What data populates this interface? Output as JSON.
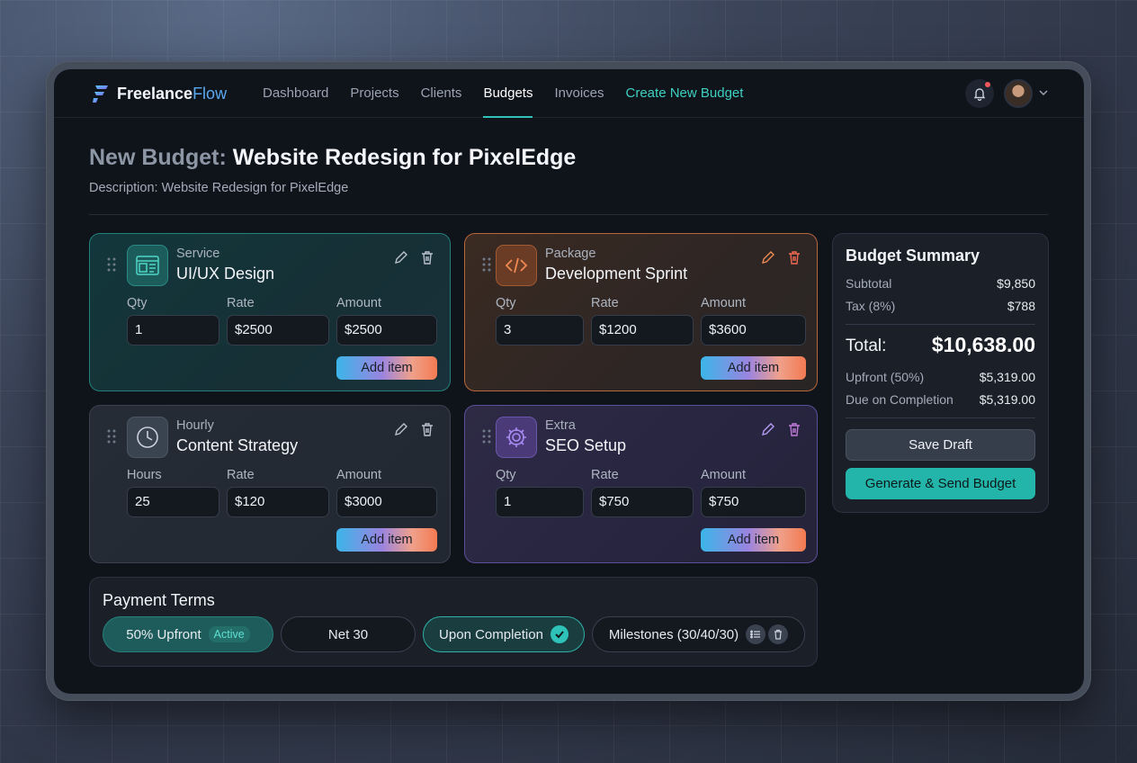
{
  "app": {
    "brand_first": "Freelance",
    "brand_second": "Flow"
  },
  "nav": {
    "items": [
      {
        "label": "Dashboard"
      },
      {
        "label": "Projects"
      },
      {
        "label": "Clients"
      },
      {
        "label": "Budgets",
        "active": true
      },
      {
        "label": "Invoices"
      },
      {
        "label": "Create New Budget"
      }
    ]
  },
  "header": {
    "notification_icon": "bell-icon",
    "has_unread": true
  },
  "page": {
    "title_prefix": "New Budget:",
    "title": "Website Redesign for PixelEdge",
    "description": "Description: Website Redesign for PixelEdge"
  },
  "line_items": [
    {
      "type": "Service",
      "name": "UI/UX Design",
      "icon": "wireframe-icon",
      "qty_label": "Qty",
      "qty": "1",
      "rate_label": "Rate",
      "rate": "$2500",
      "amount_label": "Amount",
      "amount": "$2500",
      "add_label": "Add item",
      "accent": "#24807c"
    },
    {
      "type": "Package",
      "name": "Development Sprint",
      "icon": "code-icon",
      "qty_label": "Qty",
      "qty": "3",
      "rate_label": "Rate",
      "rate": "$1200",
      "amount_label": "Amount",
      "amount": "$3600",
      "add_label": "Add item",
      "accent": "#b8663a"
    },
    {
      "type": "Hourly",
      "name": "Content Strategy",
      "icon": "clock-icon",
      "qty_label": "Hours",
      "qty": "25",
      "rate_label": "Rate",
      "rate": "$120",
      "amount_label": "Amount",
      "amount": "$3000",
      "add_label": "Add item",
      "accent": "#3a4250"
    },
    {
      "type": "Extra",
      "name": "SEO Setup",
      "icon": "gear-icon",
      "qty_label": "Qty",
      "qty": "1",
      "rate_label": "Rate",
      "rate": "$750",
      "amount_label": "Amount",
      "amount": "$750",
      "add_label": "Add item",
      "accent": "#5c4f9a"
    }
  ],
  "summary": {
    "title": "Budget Summary",
    "subtotal_label": "Subtotal",
    "subtotal": "$9,850",
    "tax_label": "Tax (8%)",
    "tax": "$788",
    "total_label": "Total:",
    "total": "$10,638.00",
    "upfront_label": "Upfront (50%)",
    "upfront": "$5,319.00",
    "due_label": "Due on Completion",
    "due": "$5,319.00",
    "save_label": "Save Draft",
    "generate_label": "Generate & Send Budget"
  },
  "payment_terms": {
    "title": "Payment Terms",
    "options": [
      {
        "label": "50% Upfront",
        "badge": "Active"
      },
      {
        "label": "Net 30"
      },
      {
        "label": "Upon Completion",
        "selected": true
      },
      {
        "label": "Milestones (30/40/30)"
      }
    ]
  },
  "colors": {
    "accent": "#2fc2b9",
    "background": "#0f131a"
  }
}
